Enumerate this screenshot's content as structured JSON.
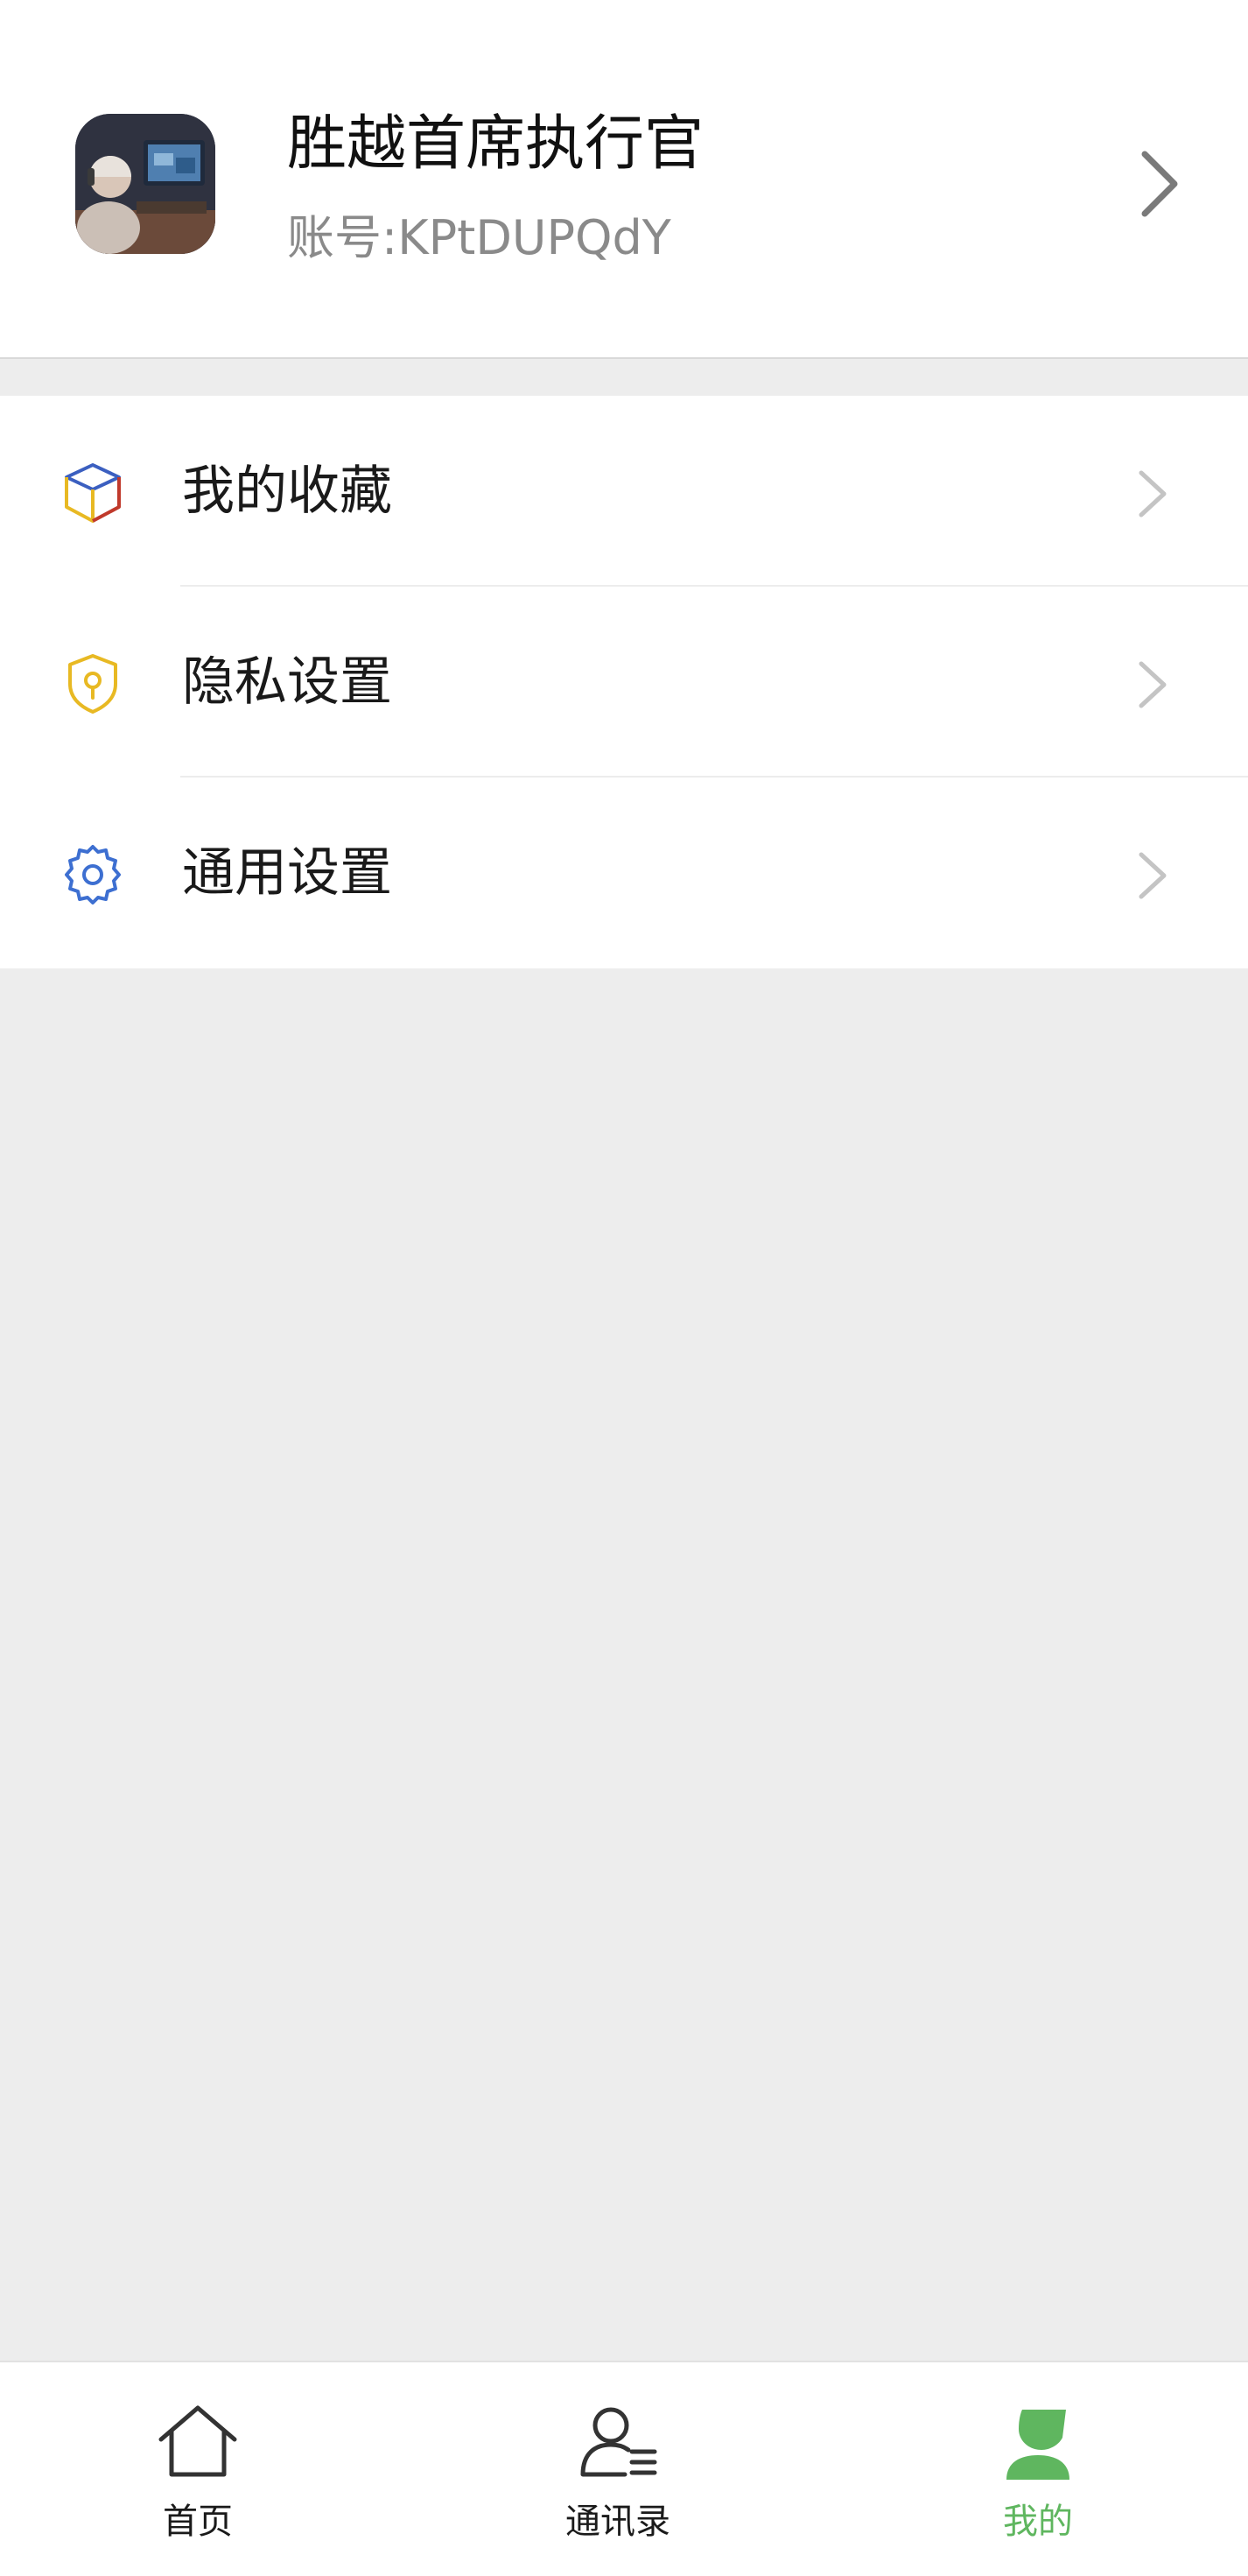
{
  "profile": {
    "name": "胜越首席执行官",
    "account": "账号:KPtDUPQdY"
  },
  "menu": {
    "items": [
      {
        "label": "我的收藏",
        "icon": "cube-icon"
      },
      {
        "label": "隐私设置",
        "icon": "shield-key-icon"
      },
      {
        "label": "通用设置",
        "icon": "gear-icon"
      }
    ]
  },
  "tabbar": {
    "tabs": [
      {
        "label": "首页",
        "icon": "home-icon",
        "active": false
      },
      {
        "label": "通讯录",
        "icon": "contacts-icon",
        "active": false
      },
      {
        "label": "我的",
        "icon": "person-icon",
        "active": true
      }
    ]
  },
  "colors": {
    "accent": "#5fb65f",
    "background": "#ededed",
    "cube_blue": "#3b5fc0",
    "cube_red": "#c0392b",
    "cube_yellow": "#e8b923",
    "shield_yellow": "#e8b923",
    "gear_blue": "#3d6fd1"
  }
}
